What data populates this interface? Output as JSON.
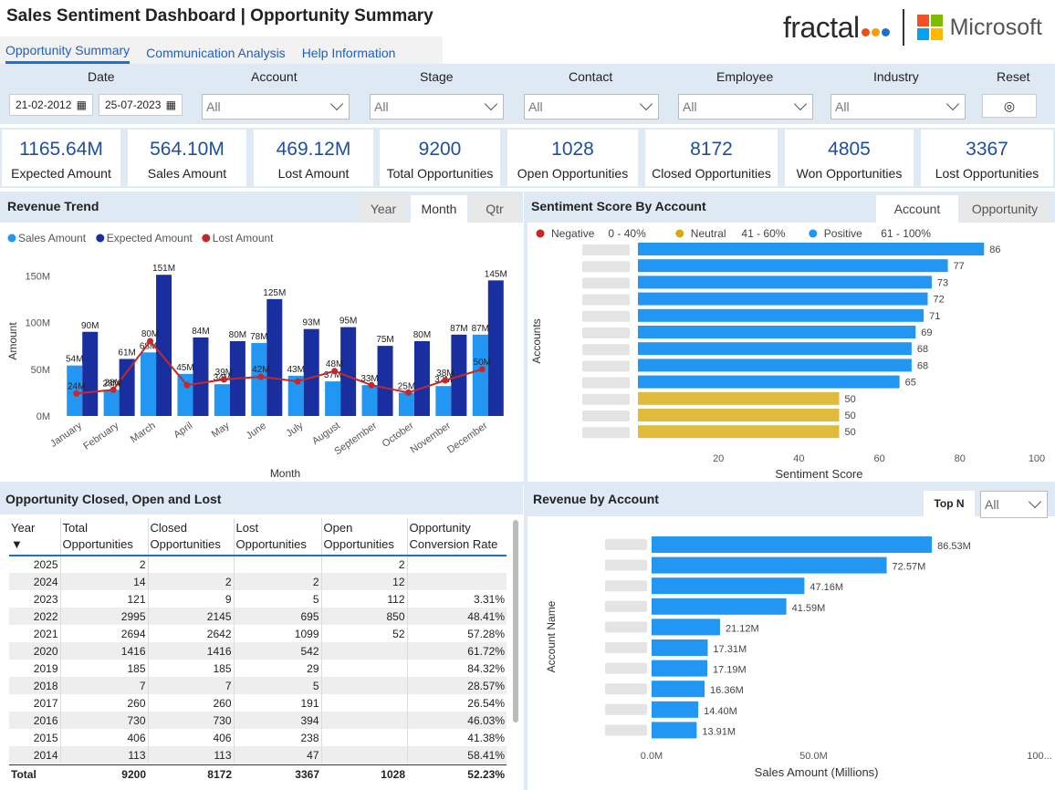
{
  "header": {
    "title": "Sales Sentiment Dashboard | Opportunity Summary",
    "fractal_logo": "fractal",
    "microsoft_logo": "Microsoft",
    "ms_colors": [
      "#f25022",
      "#7fba00",
      "#00a4ef",
      "#ffb900"
    ],
    "fractal_dot_colors": [
      "#e94e1b",
      "#f4a100",
      "#1f6fd1"
    ]
  },
  "tabs": [
    "Opportunity Summary",
    "Communication Analysis",
    "Help Information"
  ],
  "filters": {
    "date_label": "Date",
    "date_from": "21-02-2012",
    "date_to": "25-07-2023",
    "account_label": "Account",
    "account_value": "All",
    "stage_label": "Stage",
    "stage_value": "All",
    "contact_label": "Contact",
    "contact_value": "All",
    "employee_label": "Employee",
    "employee_value": "All",
    "industry_label": "Industry",
    "industry_value": "All",
    "reset_label": "Reset"
  },
  "kpis": [
    {
      "value": "1165.64M",
      "label": "Expected Amount"
    },
    {
      "value": "564.10M",
      "label": "Sales Amount"
    },
    {
      "value": "469.12M",
      "label": "Lost Amount"
    },
    {
      "value": "9200",
      "label": "Total Opportunities"
    },
    {
      "value": "1028",
      "label": "Open Opportunities"
    },
    {
      "value": "8172",
      "label": "Closed Opportunities"
    },
    {
      "value": "4805",
      "label": "Won Opportunities"
    },
    {
      "value": "3367",
      "label": "Lost Opportunities"
    }
  ],
  "revenue_trend": {
    "title": "Revenue Trend",
    "toggles": [
      "Year",
      "Month",
      "Qtr"
    ]
  },
  "sentiment": {
    "title": "Sentiment Score By Account",
    "toggles": [
      "Account",
      "Opportunity"
    ]
  },
  "opp_table": {
    "title": "Opportunity Closed, Open and Lost",
    "headers": [
      "Year",
      "Total Opportunities",
      "Closed Opportunities",
      "Lost Opportunities",
      "Open Opportunities",
      "Opportunity Conversion Rate"
    ],
    "rows": [
      [
        "2025",
        "2",
        "",
        "",
        "2",
        ""
      ],
      [
        "2024",
        "14",
        "2",
        "2",
        "12",
        ""
      ],
      [
        "2023",
        "121",
        "9",
        "5",
        "112",
        "3.31%"
      ],
      [
        "2022",
        "2995",
        "2145",
        "695",
        "850",
        "48.41%"
      ],
      [
        "2021",
        "2694",
        "2642",
        "1099",
        "52",
        "57.28%"
      ],
      [
        "2020",
        "1416",
        "1416",
        "542",
        "",
        "61.72%"
      ],
      [
        "2019",
        "185",
        "185",
        "29",
        "",
        "84.32%"
      ],
      [
        "2018",
        "7",
        "7",
        "5",
        "",
        "28.57%"
      ],
      [
        "2017",
        "260",
        "260",
        "191",
        "",
        "26.54%"
      ],
      [
        "2016",
        "730",
        "730",
        "394",
        "",
        "46.03%"
      ],
      [
        "2015",
        "406",
        "406",
        "238",
        "",
        "41.38%"
      ],
      [
        "2014",
        "113",
        "113",
        "47",
        "",
        "58.41%"
      ]
    ],
    "total": [
      "Total",
      "9200",
      "8172",
      "3367",
      "1028",
      "52.23%"
    ]
  },
  "revenue_by_account": {
    "title": "Revenue by Account",
    "topn_label": "Top N",
    "topn_value": "All"
  },
  "chart_data": [
    {
      "type": "bar",
      "title": "Revenue Trend",
      "categories": [
        "January",
        "February",
        "March",
        "April",
        "May",
        "June",
        "July",
        "August",
        "September",
        "October",
        "November",
        "December"
      ],
      "series": [
        {
          "name": "Sales Amount",
          "values": [
            54,
            28,
            68,
            45,
            34,
            78,
            43,
            37,
            33,
            25,
            32,
            87
          ],
          "labels": [
            "54M",
            "28M",
            "68M",
            "45M",
            "34M",
            "78M",
            "43M",
            "37M",
            "33M",
            "25M",
            "32M",
            "87M"
          ],
          "color": "#2196f3"
        },
        {
          "name": "Expected Amount",
          "values": [
            90,
            61,
            151,
            84,
            80,
            125,
            93,
            95,
            75,
            80,
            87,
            145
          ],
          "labels": [
            "90M",
            "61M",
            "151M",
            "84M",
            "80M",
            "125M",
            "93M",
            "95M",
            "75M",
            "80M",
            "87M",
            "145M"
          ],
          "color": "#1a2f9f"
        },
        {
          "name": "Lost Amount",
          "type": "line",
          "values": [
            24,
            28,
            80,
            33,
            39,
            42,
            37,
            48,
            33,
            25,
            38,
            50
          ],
          "labels": [
            "24M",
            "28M",
            "80M",
            "",
            "39M",
            "42M",
            "",
            "48M",
            "",
            "",
            "38M",
            "50M"
          ],
          "color": "#c62828"
        }
      ],
      "xlabel": "Month",
      "ylabel": "Amount",
      "yticks": [
        "0M",
        "50M",
        "100M",
        "150M"
      ],
      "ylim": [
        0,
        160
      ],
      "legend_position": "top-left"
    },
    {
      "type": "bar",
      "orientation": "horizontal",
      "title": "Sentiment Score By Account",
      "legend": [
        {
          "name": "Negative",
          "range": "0 -  40%",
          "color": "#c62828"
        },
        {
          "name": "Neutral",
          "range": "41 - 60%",
          "color": "#d4ac0d"
        },
        {
          "name": "Positive",
          "range": "61 - 100%",
          "color": "#2196f3"
        }
      ],
      "values": [
        86,
        77,
        73,
        72,
        71,
        69,
        68,
        68,
        65,
        50,
        50,
        50
      ],
      "colors": [
        "#2196f3",
        "#2196f3",
        "#2196f3",
        "#2196f3",
        "#2196f3",
        "#2196f3",
        "#2196f3",
        "#2196f3",
        "#2196f3",
        "#e0bb3c",
        "#e0bb3c",
        "#e0bb3c"
      ],
      "xticks": [
        "20",
        "40",
        "60",
        "80",
        "100"
      ],
      "xlim": [
        0,
        100
      ],
      "xlabel": "Sentiment Score",
      "ylabel": "Accounts"
    },
    {
      "type": "bar",
      "orientation": "horizontal",
      "title": "Revenue by Account",
      "values": [
        86.53,
        72.57,
        47.16,
        41.59,
        21.12,
        17.31,
        17.19,
        16.36,
        14.4,
        13.91
      ],
      "labels": [
        "86.53M",
        "72.57M",
        "47.16M",
        "41.59M",
        "21.12M",
        "17.31M",
        "17.19M",
        "16.36M",
        "14.40M",
        "13.91M"
      ],
      "color": "#2196f3",
      "xticks": [
        "0.0M",
        "50.0M",
        "100..."
      ],
      "xlim": [
        0,
        100
      ],
      "xlabel": "Sales Amount (Millions)",
      "ylabel": "Account Name"
    }
  ]
}
